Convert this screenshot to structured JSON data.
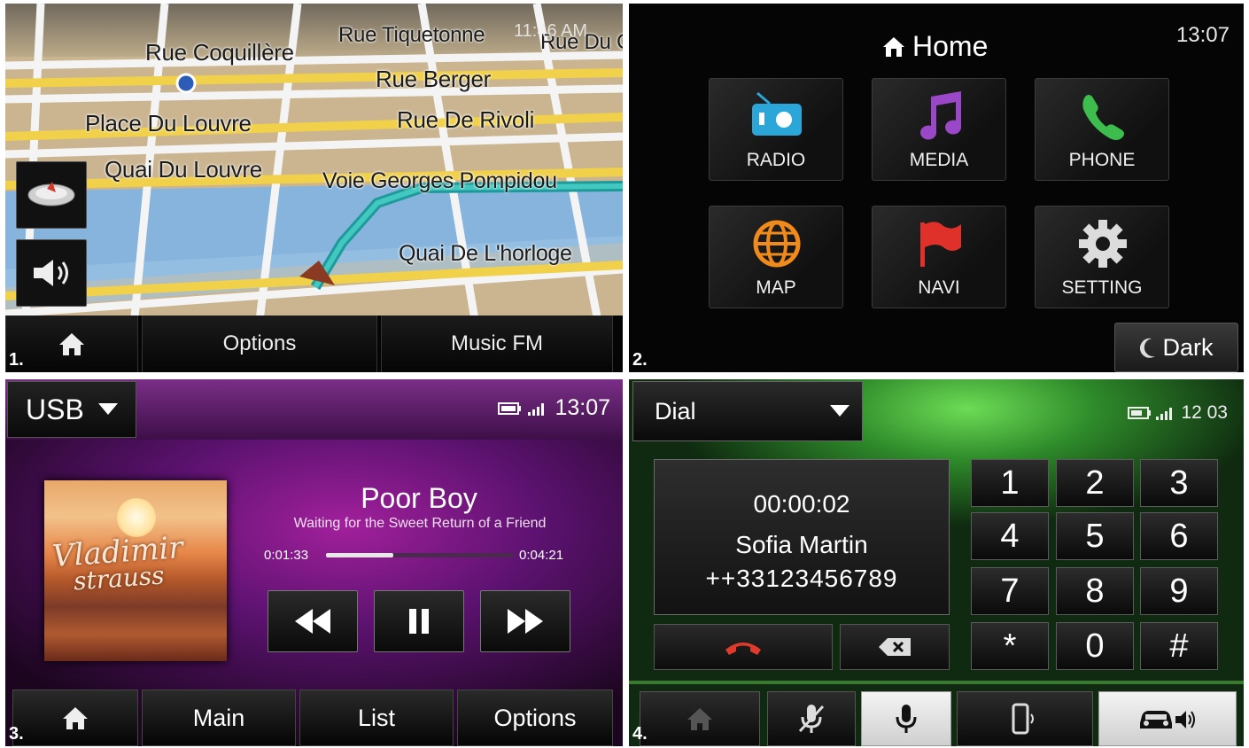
{
  "panel1": {
    "number": "1.",
    "clock": "11:46 AM",
    "streets": {
      "rue_coquilliere": "Rue Coquillère",
      "rue_tiquetonne": "Rue Tiquetonne",
      "rue_du": "Rue Du C",
      "rue_berger": "Rue Berger",
      "place_du_louvre": "Place Du Louvre",
      "rue_de_rivoli": "Rue De Rivoli",
      "quai_du_louvre": "Quai Du Louvre",
      "voie_georges": "Voie Georges Pompidou",
      "quai_horloge": "Quai De L'horloge"
    },
    "bottom_bar": {
      "home_icon": "home-icon",
      "options_label": "Options",
      "music_label": "Music FM"
    },
    "side_buttons": [
      "compass-icon",
      "volume-icon"
    ]
  },
  "panel2": {
    "number": "2.",
    "title": "Home",
    "clock": "13:07",
    "tiles": [
      {
        "label": "RADIO",
        "icon": "radio-icon",
        "color": "#2aa6d8"
      },
      {
        "label": "MEDIA",
        "icon": "music-note-icon",
        "color": "#9b48c8"
      },
      {
        "label": "PHONE",
        "icon": "phone-icon",
        "color": "#3dbd4e"
      },
      {
        "label": "MAP",
        "icon": "globe-icon",
        "color": "#f08a1a"
      },
      {
        "label": "NAVI",
        "icon": "flag-icon",
        "color": "#e0302a"
      },
      {
        "label": "SETTING",
        "icon": "gear-icon",
        "color": "#d8d8d8"
      }
    ],
    "dark_label": "Dark"
  },
  "panel3": {
    "number": "3.",
    "source": "USB",
    "clock": "13:07",
    "album_text": [
      "Vladimir",
      "strauss"
    ],
    "song_title": "Poor Boy",
    "album_name": "Waiting for the Sweet Return of a Friend",
    "time_current": "0:01:33",
    "time_total": "0:04:21",
    "progress": 0.36,
    "bottom_bar": {
      "home_icon": "home-icon",
      "main_label": "Main",
      "list_label": "List",
      "options_label": "Options"
    }
  },
  "panel4": {
    "number": "4.",
    "mode": "Dial",
    "clock": "12 03",
    "call_time": "00:00:02",
    "caller_name": "Sofia Martin",
    "caller_number": "++33123456789",
    "keys": [
      "1",
      "2",
      "3",
      "4",
      "5",
      "6",
      "7",
      "8",
      "9",
      "*",
      "0",
      "#"
    ],
    "bottom_icons": [
      "home-icon",
      "mic-off-icon",
      "mic-icon",
      "phone-speaker-icon",
      "car-speaker-icon"
    ]
  }
}
